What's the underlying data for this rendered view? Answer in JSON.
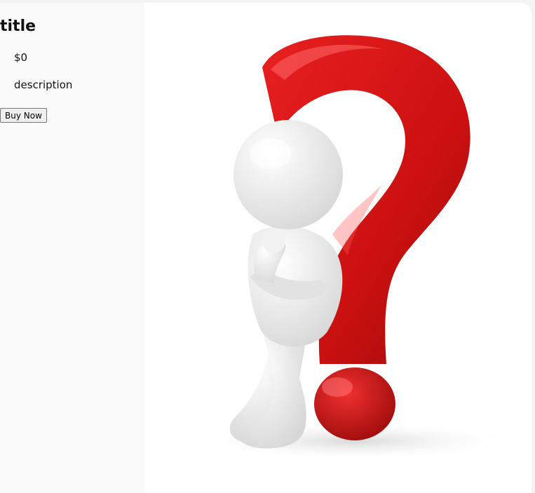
{
  "product": {
    "title": "title",
    "price": "$0",
    "description": "description",
    "buy_label": "Buy Now",
    "image_icon": "thinking-figure-with-question-mark-icon"
  },
  "colors": {
    "question_mark": "#d41414",
    "question_mark_dark": "#9c0c0c",
    "figure": "#ececec",
    "background": "#fafafa"
  }
}
